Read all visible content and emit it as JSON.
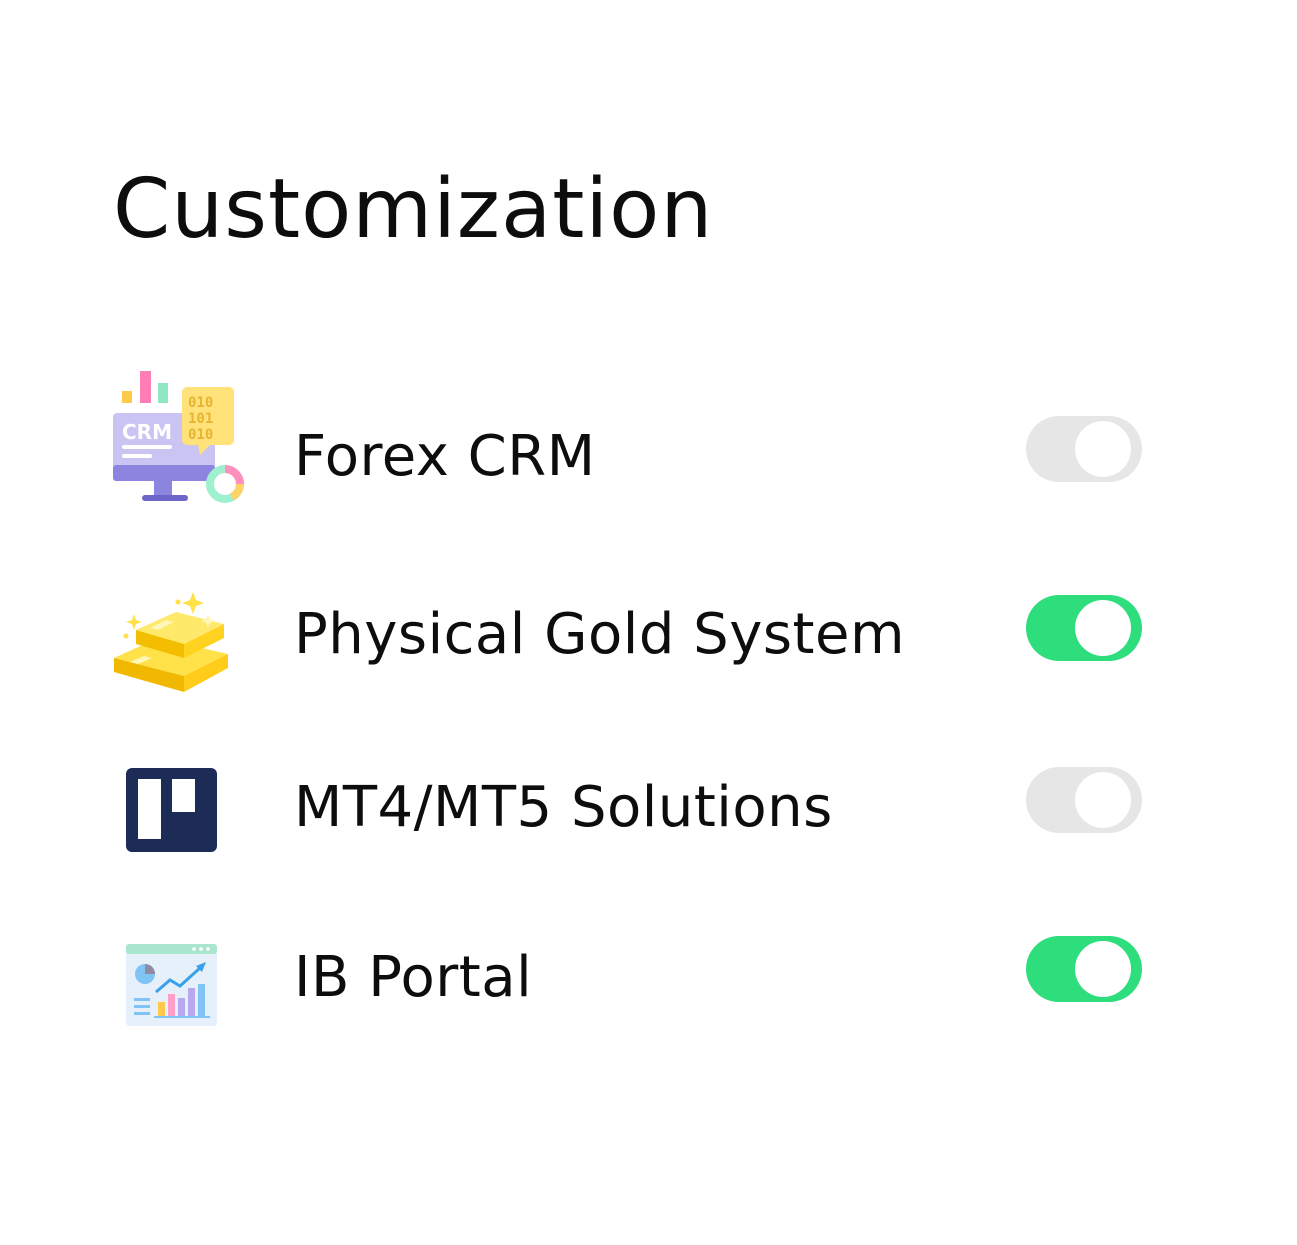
{
  "title": "Customization",
  "colors": {
    "toggle_on": "#2edd7c",
    "toggle_off": "#e6e6e6"
  },
  "items": [
    {
      "label": "Forex CRM",
      "icon": "crm-monitor-icon",
      "enabled": false
    },
    {
      "label": "Physical Gold System",
      "icon": "gold-bars-icon",
      "enabled": true
    },
    {
      "label": "MT4/MT5 Solutions",
      "icon": "board-icon",
      "enabled": false
    },
    {
      "label": "IB Portal",
      "icon": "analytics-dashboard-icon",
      "enabled": true
    }
  ]
}
